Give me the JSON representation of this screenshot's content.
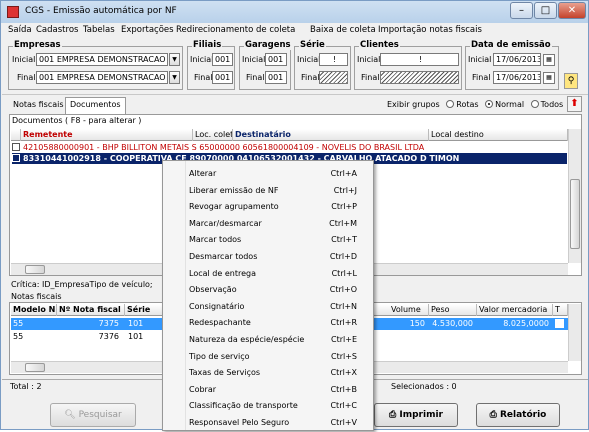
{
  "window": {
    "title": "CGS - Emissão automática por NF",
    "minimize": "–",
    "maximize": "□",
    "close": "✕"
  },
  "menu": [
    "Saída",
    "Cadastros",
    "Tabelas",
    "Exportações",
    "Redirecionamento de coleta",
    "Baixa de coleta",
    "Importação notas fiscais"
  ],
  "filters": {
    "empresas": {
      "title": "Empresas",
      "inicial_label": "Inicial",
      "final_label": "Final",
      "inicial": "001 EMPRESA DEMONSTRACAO",
      "final": "001 EMPRESA DEMONSTRACAO"
    },
    "filiais": {
      "title": "Filiais",
      "inicial_label": "Inicial",
      "final_label": "Final",
      "inicial": "001",
      "final": "001"
    },
    "garagens": {
      "title": "Garagens",
      "inicial_label": "Inicial",
      "final_label": "Final",
      "inicial": "001",
      "final": "001"
    },
    "serie": {
      "title": "Série",
      "inicial_label": "Inicial",
      "final_label": "Final",
      "inicial": "!",
      "final": ""
    },
    "clientes": {
      "title": "Clientes",
      "inicial_label": "Inicial",
      "final_label": "Final",
      "inicial": "!",
      "final": ""
    },
    "data_emissao": {
      "title": "Data de emissão",
      "inicial_label": "Inicial",
      "final_label": "Final",
      "inicial": "17/06/2013",
      "final": "17/06/2013"
    }
  },
  "tabs": [
    "Notas fiscais",
    "Documentos"
  ],
  "exibir": {
    "label": "Exibir grupos",
    "options": [
      "Rotas",
      "Normal",
      "Todos"
    ],
    "selected": "Normal"
  },
  "documentos": {
    "caption": "Documentos ( F8 - para alterar )",
    "columns": [
      "Remetente",
      "Loc. coleta",
      "Destinatário",
      "Local destino"
    ],
    "rows": [
      {
        "text": "42105880000901 - BHP BILLITON METAIS S   65000000 60561800004109 - NOVELIS DO BRASIL LTDA",
        "selected": false
      },
      {
        "text": "83310441002918 - COOPERATIVA CE 89070000 04106532001432 - CARVALHO ATACADO D TIMON",
        "selected": true
      }
    ]
  },
  "critica": "Crítica: ID_EmpresaTipo de veículo;",
  "notas": {
    "caption": "Notas fiscais",
    "columns": [
      "Modelo NF",
      "Nº Nota fiscal",
      "Série",
      "Volume",
      "Peso",
      "Valor mercadoria",
      "T"
    ],
    "rows": [
      {
        "modelo": "55",
        "numero": "7375",
        "serie": "101",
        "volume": "150",
        "peso": "4.530,000",
        "valor": "8.025,0000",
        "selected": true
      },
      {
        "modelo": "55",
        "numero": "7376",
        "serie": "101",
        "volume": "",
        "peso": "",
        "valor": "",
        "selected": false
      }
    ]
  },
  "status": {
    "total": "Total : 2",
    "selecionados": "Selecionados : 0"
  },
  "buttons": {
    "pesquisar": "Pesquisar",
    "imprimir": "Imprimir",
    "relatorio": "Relatório"
  },
  "context_menu": [
    {
      "label": "Alterar",
      "shortcut": "Ctrl+A"
    },
    {
      "label": "Liberar emissão de NF",
      "shortcut": "Ctrl+J"
    },
    {
      "label": "Revogar agrupamento",
      "shortcut": "Ctrl+P"
    },
    {
      "label": "Marcar/desmarcar",
      "shortcut": "Ctrl+M"
    },
    {
      "label": "Marcar todos",
      "shortcut": "Ctrl+T"
    },
    {
      "label": "Desmarcar todos",
      "shortcut": "Ctrl+D"
    },
    {
      "label": "Local de entrega",
      "shortcut": "Ctrl+L"
    },
    {
      "label": "Observação",
      "shortcut": "Ctrl+O"
    },
    {
      "label": "Consignatário",
      "shortcut": "Ctrl+N"
    },
    {
      "label": "Redespachante",
      "shortcut": "Ctrl+R"
    },
    {
      "label": "Natureza da espécie/espécie",
      "shortcut": "Ctrl+E"
    },
    {
      "label": "Tipo de serviço",
      "shortcut": "Ctrl+S"
    },
    {
      "label": "Taxas de Serviços",
      "shortcut": "Ctrl+X"
    },
    {
      "label": "Cobrar",
      "shortcut": "Ctrl+B"
    },
    {
      "label": "Classificação de transporte",
      "shortcut": "Ctrl+C"
    },
    {
      "label": "Responsavel Pelo Seguro",
      "shortcut": "Ctrl+V"
    }
  ],
  "colors": {
    "selection": "#0a246a",
    "red_text": "#c00000",
    "highlight_blue": "#3399ff"
  }
}
